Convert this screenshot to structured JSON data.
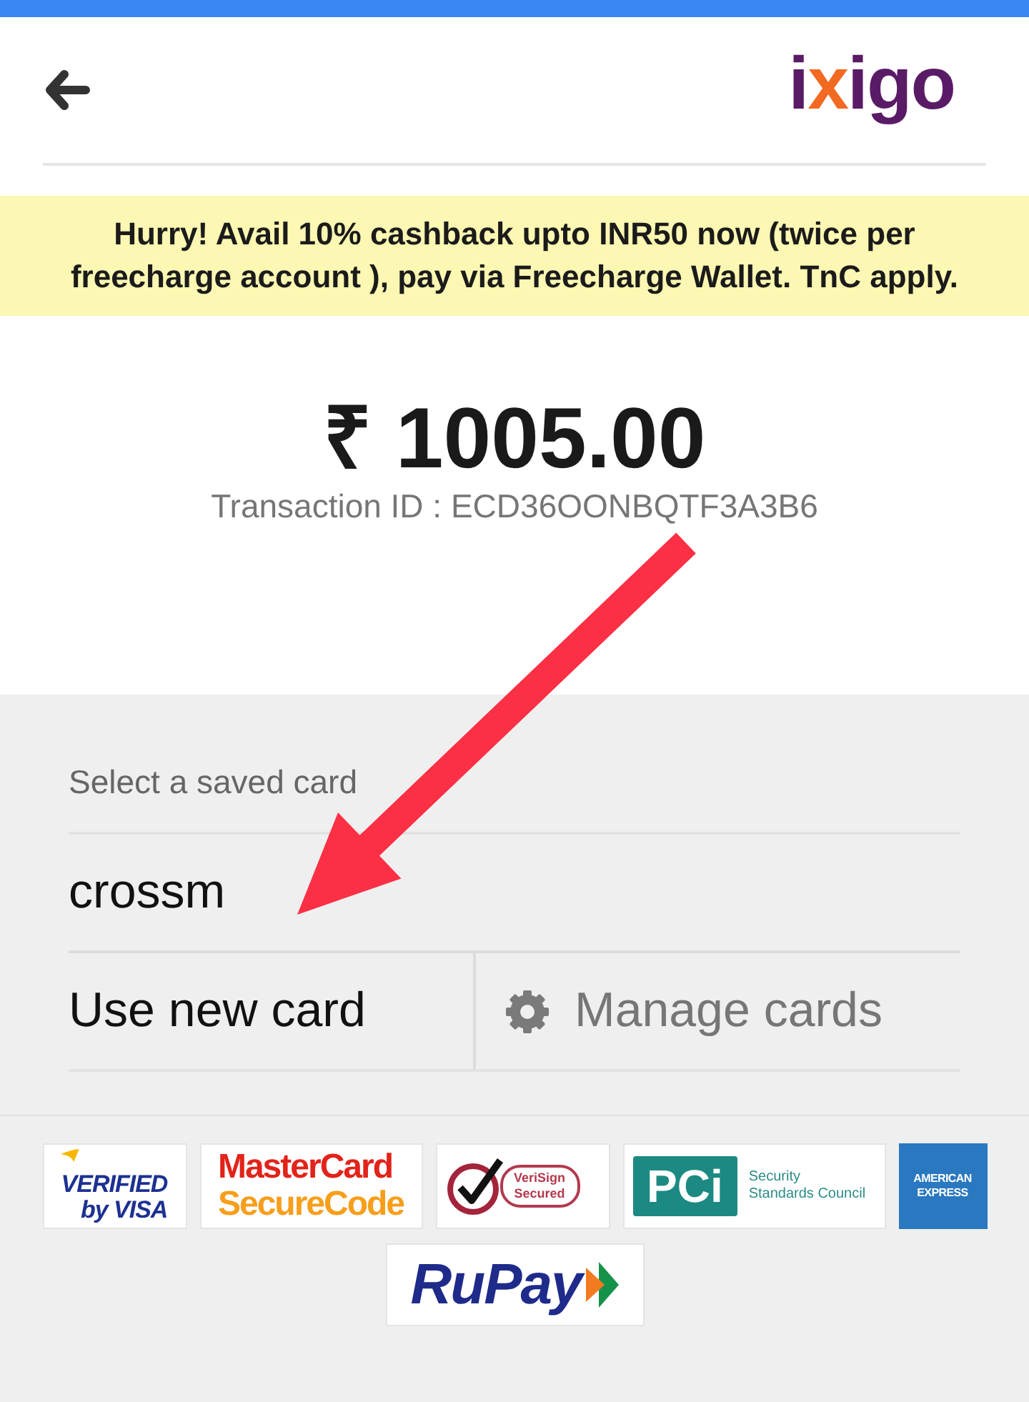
{
  "header": {
    "logo": "ixigo"
  },
  "banner": {
    "text": "Hurry! Avail 10% cashback upto INR50 now (twice per freecharge account ), pay via Freecharge Wallet. TnC apply."
  },
  "payment": {
    "amount": "₹ 1005.00",
    "transaction_id": "Transaction ID : ECD36OONBQTF3A3B6"
  },
  "saved_cards": {
    "label": "Select a saved card",
    "cards": [
      {
        "name": "crossm"
      }
    ]
  },
  "actions": [
    {
      "kind": "new_card",
      "label": "Use new card"
    },
    {
      "kind": "manage",
      "label": "Manage cards"
    }
  ],
  "security_logos": [
    {
      "kind": "visa",
      "lines": [
        "VERIFIED",
        "by VISA"
      ]
    },
    {
      "kind": "mastercard",
      "lines": [
        "MasterCard",
        "SecureCode"
      ]
    },
    {
      "kind": "verisign",
      "lines": [
        "VeriSign",
        "Secured"
      ]
    },
    {
      "kind": "pci",
      "lines": [
        "PCi",
        "Security",
        "Standards Council"
      ]
    },
    {
      "kind": "amex",
      "lines": [
        "AMERICAN",
        "EXPRESS"
      ]
    },
    {
      "kind": "rupay",
      "lines": [
        "RuPay"
      ]
    }
  ]
}
